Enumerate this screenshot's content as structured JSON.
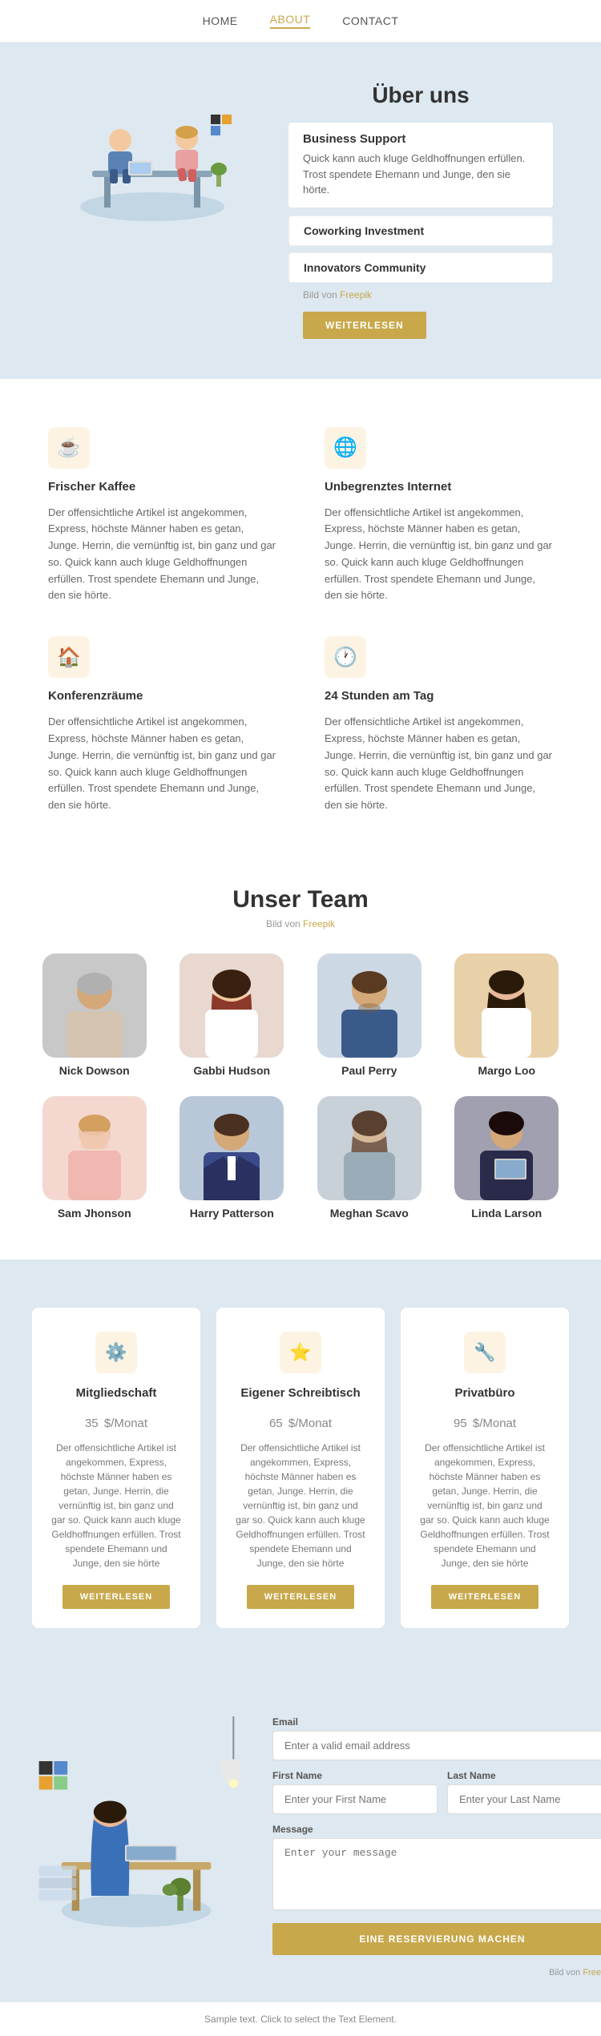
{
  "nav": {
    "items": [
      {
        "label": "HOME",
        "href": "#",
        "active": false
      },
      {
        "label": "ABOUT",
        "href": "#",
        "active": true
      },
      {
        "label": "CONTACT",
        "href": "#",
        "active": false
      }
    ]
  },
  "about": {
    "title": "Über uns",
    "cards": [
      {
        "id": "business-support",
        "title": "Business Support",
        "text": "Quick kann auch kluge Geldhoffnungen erfüllen. Trost spendete Ehemann und Junge, den sie hörte.",
        "active": true
      }
    ],
    "plain_cards": [
      {
        "label": "Coworking Investment"
      },
      {
        "label": "Innovators Community"
      }
    ],
    "freepik_label": "Bild von ",
    "freepik_link_text": "Freepik",
    "button_label": "WEITERLESEN"
  },
  "features": {
    "items": [
      {
        "icon": "☕",
        "title": "Frischer Kaffee",
        "text": "Der offensichtliche Artikel ist angekommen, Express, höchste Männer haben es getan, Junge. Herrin, die vernünftig ist, bin ganz und gar so. Quick kann auch kluge Geldhoffnungen erfüllen. Trost spendete Ehemann und Junge, den sie hörte."
      },
      {
        "icon": "🌐",
        "title": "Unbegrenztes Internet",
        "text": "Der offensichtliche Artikel ist angekommen, Express, höchste Männer haben es getan, Junge. Herrin, die vernünftig ist, bin ganz und gar so. Quick kann auch kluge Geldhoffnungen erfüllen. Trost spendete Ehemann und Junge, den sie hörte."
      },
      {
        "icon": "🏠",
        "title": "Konferenzräume",
        "text": "Der offensichtliche Artikel ist angekommen, Express, höchste Männer haben es getan, Junge. Herrin, die vernünftig ist, bin ganz und gar so. Quick kann auch kluge Geldhoffnungen erfüllen. Trost spendete Ehemann und Junge, den sie hörte."
      },
      {
        "icon": "🕐",
        "title": "24 Stunden am Tag",
        "text": "Der offensichtliche Artikel ist angekommen, Express, höchste Männer haben es getan, Junge. Herrin, die vernünftig ist, bin ganz und gar so. Quick kann auch kluge Geldhoffnungen erfüllen. Trost spendete Ehemann und Junge, den sie hörte."
      }
    ]
  },
  "team": {
    "title": "Unser Team",
    "freepik_label": "Bild von ",
    "freepik_link_text": "Freepik",
    "members": [
      {
        "name": "Nick Dowson",
        "color": "#c5c5c5"
      },
      {
        "name": "Gabbi Hudson",
        "color": "#d4a8a0"
      },
      {
        "name": "Paul Perry",
        "color": "#b8c8d8"
      },
      {
        "name": "Margo Loo",
        "color": "#d4b896"
      },
      {
        "name": "Sam Jhonson",
        "color": "#f0c8c0"
      },
      {
        "name": "Harry Patterson",
        "color": "#a8b8c8"
      },
      {
        "name": "Meghan Scavo",
        "color": "#c0c8d0"
      },
      {
        "name": "Linda Larson",
        "color": "#a8a8b8"
      }
    ]
  },
  "pricing": {
    "cards": [
      {
        "icon": "⚙️",
        "name": "Mitgliedschaft",
        "price": "35",
        "unit": "$/Monat",
        "text": "Der offensichtliche Artikel ist angekommen, Express, höchste Männer haben es getan, Junge. Herrin, die vernünftig ist, bin ganz und gar so. Quick kann auch kluge Geldhoffnungen erfüllen. Trost spendete Ehemann und Junge, den sie hörte",
        "button": "WEITERLESEN"
      },
      {
        "icon": "⭐",
        "name": "Eigener Schreibtisch",
        "price": "65",
        "unit": "$/Monat",
        "text": "Der offensichtliche Artikel ist angekommen, Express, höchste Männer haben es getan, Junge. Herrin, die vernünftig ist, bin ganz und gar so. Quick kann auch kluge Geldhoffnungen erfüllen. Trost spendete Ehemann und Junge, den sie hörte",
        "button": "WEITERLESEN"
      },
      {
        "icon": "🔧",
        "name": "Privatbüro",
        "price": "95",
        "unit": "$/Monat",
        "text": "Der offensichtliche Artikel ist angekommen, Express, höchste Männer haben es getan, Junge. Herrin, die vernünftig ist, bin ganz und gar so. Quick kann auch kluge Geldhoffnungen erfüllen. Trost spendete Ehemann und Junge, den sie hörte",
        "button": "WEITERLESEN"
      }
    ]
  },
  "contact": {
    "fields": {
      "email": {
        "label": "Email",
        "placeholder": "Enter a valid email address"
      },
      "first_name": {
        "label": "First Name",
        "placeholder": "Enter your First Name"
      },
      "last_name": {
        "label": "Last Name",
        "placeholder": "Enter your Last Name"
      },
      "message": {
        "label": "Message",
        "placeholder": "Enter your message"
      }
    },
    "button_label": "EINE RESERVIERUNG MACHEN",
    "freepik_label": "Bild von ",
    "freepik_link_text": "Freepik"
  },
  "footer": {
    "sample_text": "Sample text. Click to select the Text Element."
  }
}
